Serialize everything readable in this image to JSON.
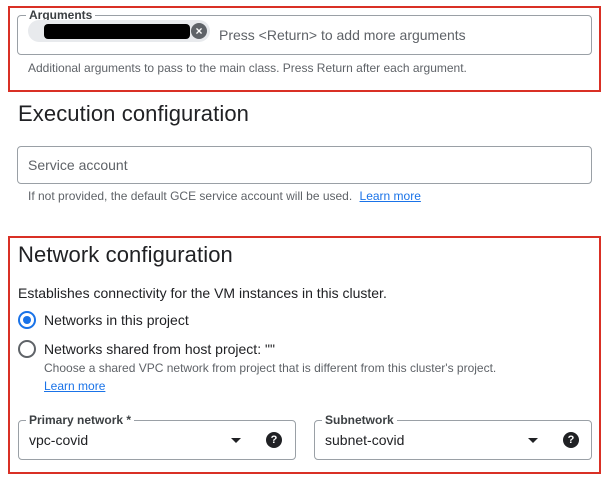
{
  "arguments": {
    "label": "Arguments",
    "chip_close": "×",
    "placeholder": "Press <Return> to add more arguments",
    "hint": "Additional arguments to pass to the main class. Press Return after each argument."
  },
  "execution": {
    "heading": "Execution configuration",
    "service_account_placeholder": "Service account",
    "hint": "If not provided, the default GCE service account will be used.",
    "learn_more": "Learn more"
  },
  "network": {
    "heading": "Network configuration",
    "description": "Establishes connectivity for the VM instances in this cluster.",
    "options": [
      {
        "label": "Networks in this project",
        "checked": true
      },
      {
        "label": "Networks shared from host project: \"\"",
        "checked": false
      }
    ],
    "shared_hint": "Choose a shared VPC network from project that is different from this cluster's project.",
    "learn_more": "Learn more",
    "primary_network": {
      "label": "Primary network *",
      "value": "vpc-covid"
    },
    "subnetwork": {
      "label": "Subnetwork",
      "value": "subnet-covid"
    },
    "help_glyph": "?"
  },
  "colors": {
    "highlight": "#d93025",
    "accent": "#1a73e8"
  }
}
